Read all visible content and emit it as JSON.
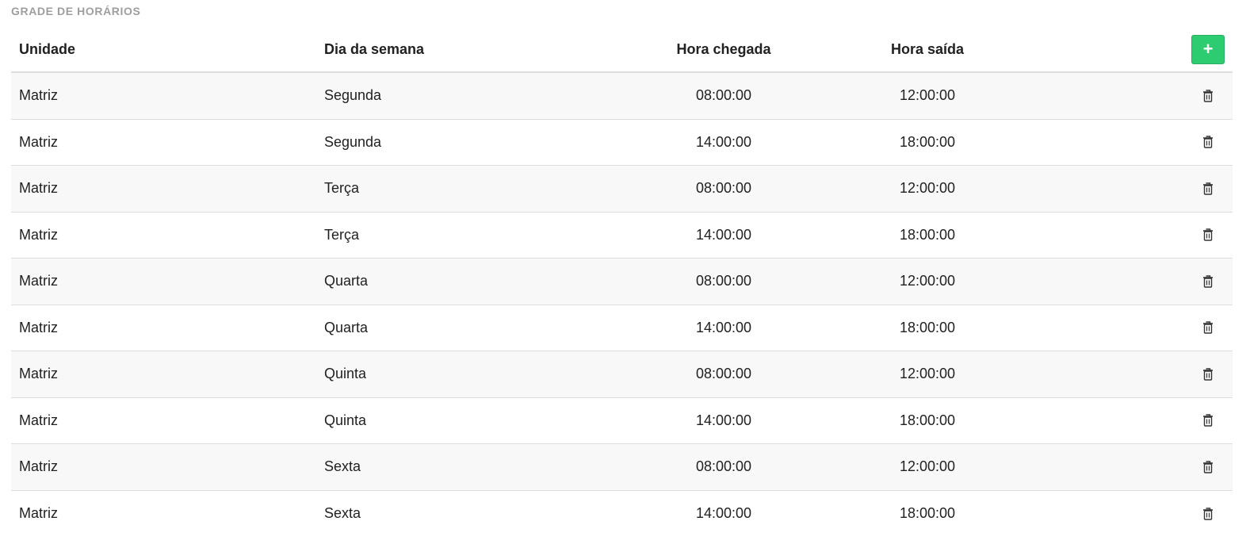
{
  "section": {
    "title": "GRADE DE HORÁRIOS"
  },
  "table": {
    "headers": {
      "unidade": "Unidade",
      "dia": "Dia da semana",
      "chegada": "Hora chegada",
      "saida": "Hora saída",
      "add_icon": "+"
    },
    "rows": [
      {
        "unidade": "Matriz",
        "dia": "Segunda",
        "chegada": "08:00:00",
        "saida": "12:00:00"
      },
      {
        "unidade": "Matriz",
        "dia": "Segunda",
        "chegada": "14:00:00",
        "saida": "18:00:00"
      },
      {
        "unidade": "Matriz",
        "dia": "Terça",
        "chegada": "08:00:00",
        "saida": "12:00:00"
      },
      {
        "unidade": "Matriz",
        "dia": "Terça",
        "chegada": "14:00:00",
        "saida": "18:00:00"
      },
      {
        "unidade": "Matriz",
        "dia": "Quarta",
        "chegada": "08:00:00",
        "saida": "12:00:00"
      },
      {
        "unidade": "Matriz",
        "dia": "Quarta",
        "chegada": "14:00:00",
        "saida": "18:00:00"
      },
      {
        "unidade": "Matriz",
        "dia": "Quinta",
        "chegada": "08:00:00",
        "saida": "12:00:00"
      },
      {
        "unidade": "Matriz",
        "dia": "Quinta",
        "chegada": "14:00:00",
        "saida": "18:00:00"
      },
      {
        "unidade": "Matriz",
        "dia": "Sexta",
        "chegada": "08:00:00",
        "saida": "12:00:00"
      },
      {
        "unidade": "Matriz",
        "dia": "Sexta",
        "chegada": "14:00:00",
        "saida": "18:00:00"
      }
    ]
  },
  "icons": {
    "add": "plus-icon",
    "delete": "trash-icon"
  },
  "colors": {
    "add_button": "#2ecc71",
    "title": "#9e9e9e",
    "row_alt": "#f8f8f8"
  }
}
